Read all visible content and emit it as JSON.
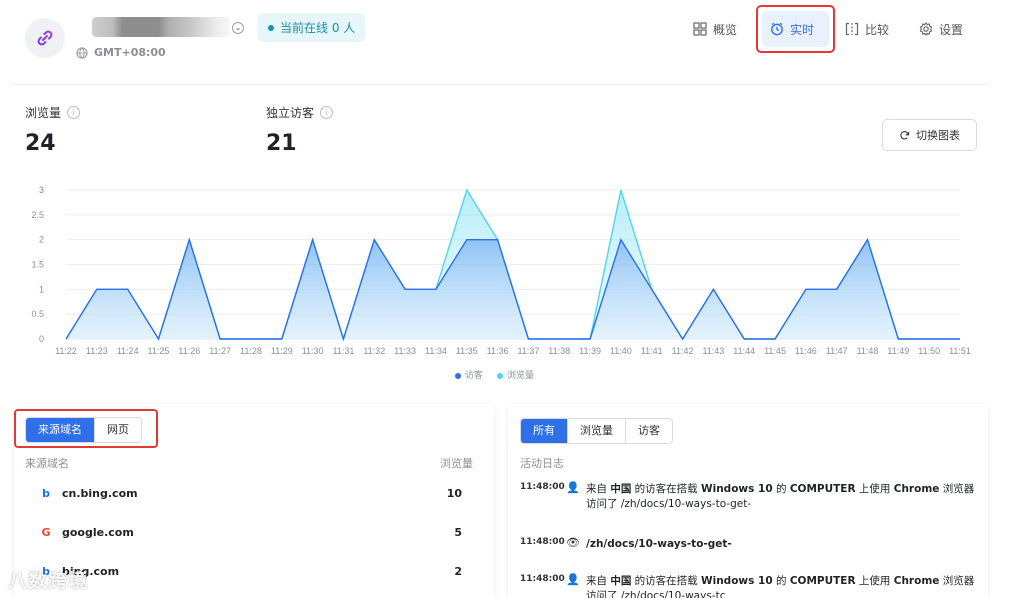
{
  "header": {
    "timezone": "GMT+08:00",
    "online_badge": "当前在线 0 人",
    "nav": [
      {
        "label": "概览",
        "icon": "grid-icon",
        "active": false
      },
      {
        "label": "实时",
        "icon": "clock-icon",
        "active": true
      },
      {
        "label": "比较",
        "icon": "compare-icon",
        "active": false
      },
      {
        "label": "设置",
        "icon": "gear-icon",
        "active": false
      }
    ]
  },
  "stats": {
    "pageviews_label": "浏览量",
    "pageviews_value": "24",
    "visitors_label": "独立访客",
    "visitors_value": "21",
    "switch_chart_label": "切换图表"
  },
  "chart_data": {
    "type": "area",
    "x": [
      "11:22",
      "11:23",
      "11:24",
      "11:25",
      "11:26",
      "11:27",
      "11:28",
      "11:29",
      "11:30",
      "11:31",
      "11:32",
      "11:33",
      "11:34",
      "11:35",
      "11:36",
      "11:37",
      "11:38",
      "11:39",
      "11:40",
      "11:41",
      "11:42",
      "11:43",
      "11:44",
      "11:45",
      "11:46",
      "11:47",
      "11:48",
      "11:49",
      "11:50",
      "11:51"
    ],
    "series": [
      {
        "name": "访客",
        "color": "#2f6fe8",
        "values": [
          0,
          1,
          1,
          0,
          2,
          0,
          0,
          0,
          2,
          0,
          2,
          1,
          1,
          2,
          2,
          0,
          0,
          0,
          2,
          1,
          0,
          1,
          0,
          0,
          1,
          1,
          2,
          0,
          0,
          0
        ]
      },
      {
        "name": "浏览量",
        "color": "#4fd6ef",
        "values": [
          0,
          1,
          1,
          0,
          2,
          0,
          0,
          0,
          2,
          0,
          2,
          1,
          1,
          3,
          2,
          0,
          0,
          0,
          3,
          1,
          0,
          1,
          0,
          0,
          1,
          1,
          2,
          0,
          0,
          0
        ]
      }
    ],
    "yticks": [
      "0",
      "0.5",
      "1",
      "1.5",
      "2",
      "2.5",
      "3"
    ],
    "ylim": [
      0,
      3
    ],
    "grid": true,
    "legend": "bottom-center"
  },
  "sources": {
    "tabs": [
      {
        "label": "来源域名",
        "active": true
      },
      {
        "label": "网页",
        "active": false
      }
    ],
    "col_name": "来源域名",
    "col_views": "浏览量",
    "rows": [
      {
        "icon": "bing-icon",
        "domain": "cn.bing.com",
        "views": "10"
      },
      {
        "icon": "google-icon",
        "domain": "google.com",
        "views": "5"
      },
      {
        "icon": "bing-icon",
        "domain": "bing.com",
        "views": "2"
      }
    ]
  },
  "activity": {
    "tabs": [
      {
        "label": "所有",
        "active": true
      },
      {
        "label": "浏览量",
        "active": false
      },
      {
        "label": "访客",
        "active": false
      }
    ],
    "title": "活动日志",
    "items": [
      {
        "time": "11:48:00",
        "icon": "user-icon",
        "text": [
          "来自 ",
          "中国",
          " 的访客在搭载 ",
          "Windows 10",
          " 的 ",
          "COMPUTER",
          " 上使用 ",
          "Chrome",
          " 浏览器"
        ],
        "line2": "访问了 /zh/docs/10-ways-to-get-"
      },
      {
        "time": "11:48:00",
        "icon": "eye-icon",
        "text": [
          "/zh/docs/10-ways-to-get-"
        ],
        "line2": ""
      },
      {
        "time": "11:48:00",
        "icon": "user-icon",
        "text": [
          "来自 ",
          "中国",
          " 的访客在搭载 ",
          "Windows 10",
          " 的 ",
          "COMPUTER",
          " 上使用 ",
          "Chrome",
          " 浏览器"
        ],
        "line2": "访问了 /zh/docs/10-ways-tc"
      }
    ]
  },
  "watermark": "八数跨境"
}
